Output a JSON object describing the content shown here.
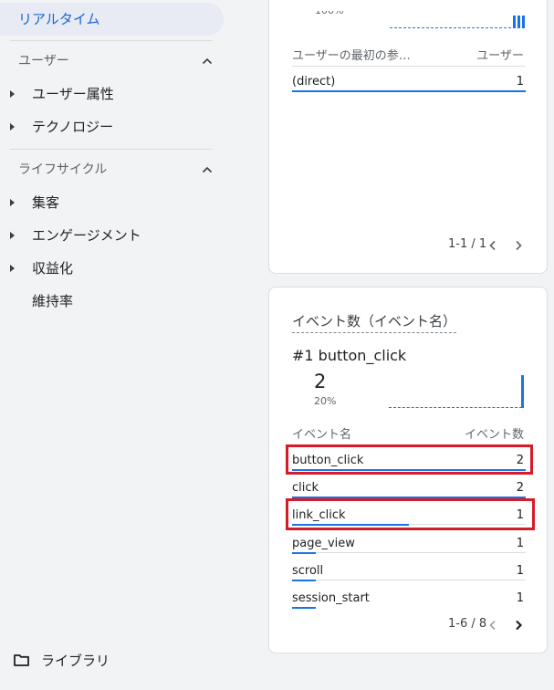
{
  "sidebar": {
    "active_item": "リアルタイム",
    "sections": [
      {
        "title": "ユーザー",
        "items": [
          "ユーザー属性",
          "テクノロジー"
        ]
      },
      {
        "title": "ライフサイクル",
        "items": [
          "集客",
          "エンゲージメント",
          "収益化"
        ]
      }
    ],
    "retention_item": "維持率",
    "library": "ライブラリ"
  },
  "card1": {
    "pct_cutoff": "100%",
    "col_left": "ユーザーの最初の参…",
    "col_right": "ユーザー",
    "rows": [
      {
        "label": "(direct)",
        "value": "1",
        "share": 1.0
      }
    ],
    "pagination": "1-1 / 1"
  },
  "card2": {
    "title": "イベント数（イベント名）",
    "rank": "#1  button_click",
    "top_value": "2",
    "top_pct": "20%",
    "col_left": "イベント名",
    "col_right": "イベント数",
    "rows": [
      {
        "label": "button_click",
        "value": "2",
        "share": 1.0
      },
      {
        "label": "click",
        "value": "2",
        "share": 1.0
      },
      {
        "label": "link_click",
        "value": "1",
        "share": 0.5
      },
      {
        "label": "page_view",
        "value": "1",
        "share": 0.1
      },
      {
        "label": "scroll",
        "value": "1",
        "share": 0.1
      },
      {
        "label": "session_start",
        "value": "1",
        "share": 0.1
      }
    ],
    "pagination": "1-6 / 8"
  },
  "colors": {
    "accent": "#1a73e8",
    "active_text": "#1967d2",
    "highlight": "#d81b28"
  }
}
